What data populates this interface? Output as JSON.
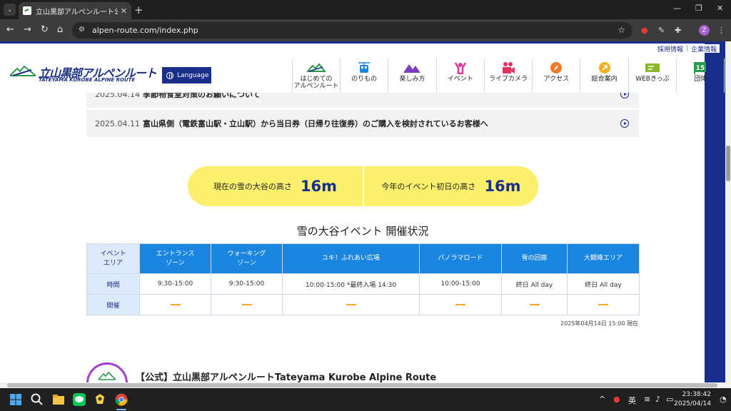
{
  "browser": {
    "tab_title": "立山黒部アルペンルート公式サ",
    "url": "alpen-route.com/index.php",
    "profile_initial": "Z"
  },
  "site": {
    "util_links": [
      "採用情報",
      "企業情報"
    ],
    "logo_text": "立山黒部アルペンルート",
    "logo_subtext": "TATEYAMA KUROBE ALPINE ROUTE",
    "language_button": "Language",
    "gnav": [
      {
        "label": "はじめての\nアルペンルート",
        "icon": "mountain-icon",
        "color": "#2a9a48"
      },
      {
        "label": "のりもの",
        "icon": "ropeway-icon",
        "color": "#1b86e0"
      },
      {
        "label": "楽しみ方",
        "icon": "mountains-icon",
        "color": "#7a3fc0"
      },
      {
        "label": "イベント",
        "icon": "person-cheer-icon",
        "color": "#d9369a"
      },
      {
        "label": "ライブカメラ",
        "icon": "video-camera-icon",
        "color": "#e2335b"
      },
      {
        "label": "アクセス",
        "icon": "compass-icon",
        "color": "#f07a2a"
      },
      {
        "label": "総合案内",
        "icon": "info-icon",
        "color": "#f2b01c"
      },
      {
        "label": "WEBきっぷ",
        "icon": "ticket-icon",
        "color": "#8ab828"
      },
      {
        "label": "団体",
        "icon": "group-flag-icon",
        "color": "#2a9a48"
      }
    ]
  },
  "news": [
    {
      "date": "2025.04.14",
      "title": "季節物食堂対策のお願いについて"
    },
    {
      "date": "2025.04.11",
      "title": "富山県側（電鉄富山駅・立山駅）から当日券（日帰り往復券）のご購入を検討されているお客様へ"
    }
  ],
  "snow_wall": {
    "current_label": "現在の雪の大谷の高さ",
    "current_value": "16m",
    "opening_label": "今年のイベント初日の高さ",
    "opening_value": "16m"
  },
  "event_status": {
    "title": "雪の大谷イベント 開催状況",
    "corner_header": "イベント\nエリア",
    "areas": [
      "エントランス\nゾーン",
      "ウォーキング\nゾーン",
      "ユキ！ふれあい広場",
      "パノラマロード",
      "雪の回廊",
      "大観峰エリア"
    ],
    "time_label": "時間",
    "times": [
      "9:30-15:00",
      "9:30-15:00",
      "10:00-15:00 *最終入場 14:30",
      "10:00-15:00",
      "終日 All day",
      "終日 All day"
    ],
    "open_label": "開催",
    "timestamp": "2025年04月14日 15:00 現在"
  },
  "promo": {
    "title": "【公式】立山黒部アルペンルートTateyama Kurobe Alpine Route"
  },
  "taskbar": {
    "ime": "英",
    "time": "23:38:42",
    "date": "2025/04/14"
  }
}
